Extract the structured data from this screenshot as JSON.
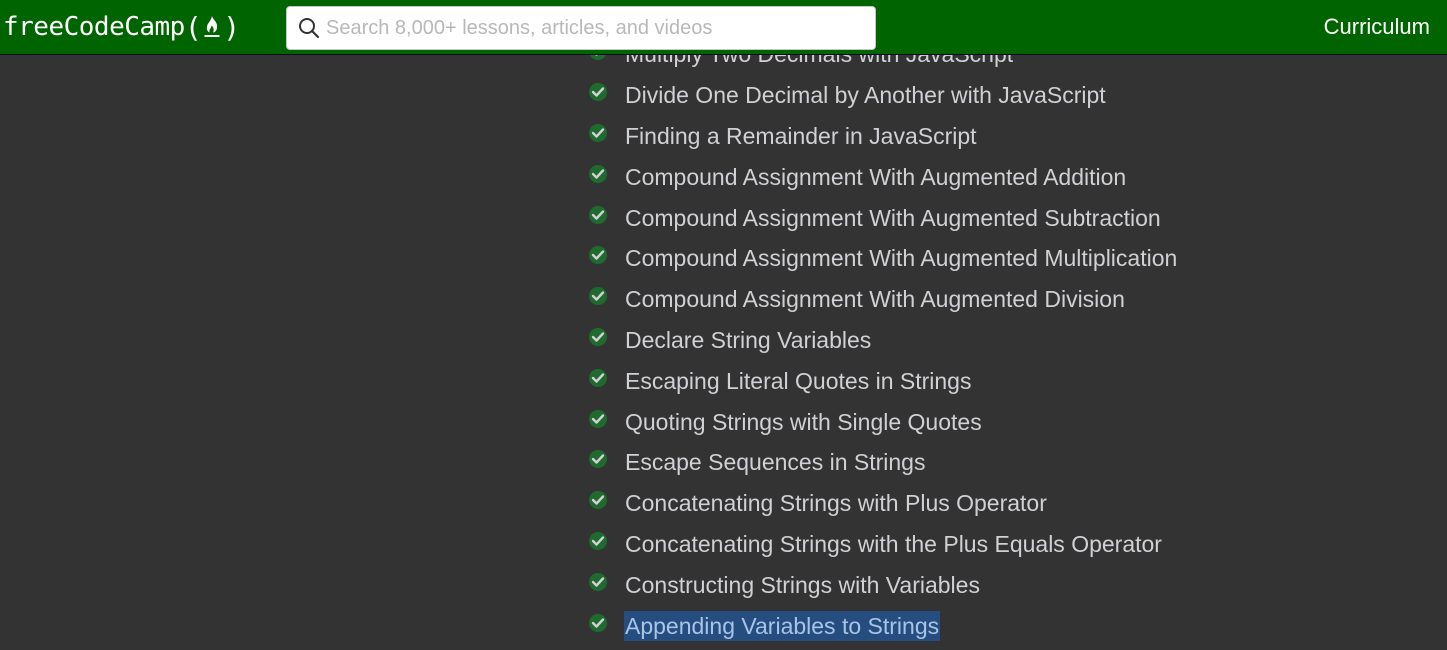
{
  "header": {
    "logo_text": "freeCodeCamp",
    "logo_open_paren": "(",
    "logo_close_paren": ")",
    "logo_icon": "flame-icon",
    "search_placeholder": "Search 8,000+ lessons, articles, and videos",
    "search_value": "",
    "search_icon": "search-icon",
    "curriculum_label": "Curriculum",
    "background_color": "#006400"
  },
  "lessons": {
    "check_icon": "check-icon",
    "check_color": "#1f6b2e",
    "items": [
      {
        "label": "Multiply Two Decimals with JavaScript",
        "completed": true,
        "selected": false
      },
      {
        "label": "Divide One Decimal by Another with JavaScript",
        "completed": true,
        "selected": false
      },
      {
        "label": "Finding a Remainder in JavaScript",
        "completed": true,
        "selected": false
      },
      {
        "label": "Compound Assignment With Augmented Addition",
        "completed": true,
        "selected": false
      },
      {
        "label": "Compound Assignment With Augmented Subtraction",
        "completed": true,
        "selected": false
      },
      {
        "label": "Compound Assignment With Augmented Multiplication",
        "completed": true,
        "selected": false
      },
      {
        "label": "Compound Assignment With Augmented Division",
        "completed": true,
        "selected": false
      },
      {
        "label": "Declare String Variables",
        "completed": true,
        "selected": false
      },
      {
        "label": "Escaping Literal Quotes in Strings",
        "completed": true,
        "selected": false
      },
      {
        "label": "Quoting Strings with Single Quotes",
        "completed": true,
        "selected": false
      },
      {
        "label": "Escape Sequences in Strings",
        "completed": true,
        "selected": false
      },
      {
        "label": "Concatenating Strings with Plus Operator",
        "completed": true,
        "selected": false
      },
      {
        "label": "Concatenating Strings with the Plus Equals Operator",
        "completed": true,
        "selected": false
      },
      {
        "label": "Constructing Strings with Variables",
        "completed": true,
        "selected": false
      },
      {
        "label": "Appending Variables to Strings",
        "completed": true,
        "selected": true
      }
    ]
  }
}
